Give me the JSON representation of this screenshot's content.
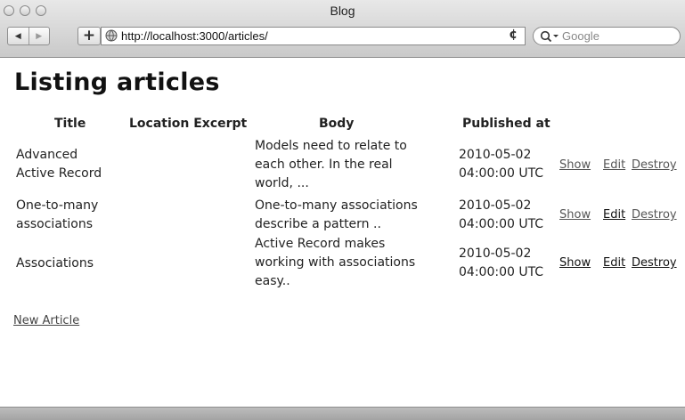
{
  "window": {
    "title": "Blog"
  },
  "toolbar": {
    "url": "http://localhost:3000/articles/",
    "search_placeholder": "Google",
    "back_icon": "back-arrow-icon",
    "forward_icon": "forward-arrow-icon",
    "add_label": "+",
    "reload_glyph": "¢"
  },
  "page": {
    "title": "Listing articles",
    "new_article_label": "New Article"
  },
  "table": {
    "headers": [
      "Title",
      "Location Excerpt",
      "Body",
      "Published at"
    ],
    "rows": [
      {
        "title_lines": [
          "Advanced",
          "Active Record"
        ],
        "body_lines": [
          "Models need to relate to",
          "each other. In the real",
          "world, ..."
        ],
        "published_lines": [
          "2010-05-02",
          "04:00:00 UTC"
        ],
        "actions": [
          "Show",
          "Edit",
          "Destroy"
        ]
      },
      {
        "title_lines": [
          "One-to-many",
          "associations"
        ],
        "body_lines": [
          "One-to-many associations",
          "describe a pattern .."
        ],
        "published_lines": [
          "2010-05-02",
          "04:00:00 UTC"
        ],
        "actions": [
          "Show",
          "Edit",
          "Destroy"
        ]
      },
      {
        "title_lines": [
          "Associations"
        ],
        "body_lines": [
          "Active Record makes",
          "working with associations",
          "easy.."
        ],
        "published_lines": [
          "2010-05-02",
          "04:00:00 UTC"
        ],
        "actions": [
          "Show",
          "Edit",
          "Destroy"
        ]
      }
    ]
  }
}
